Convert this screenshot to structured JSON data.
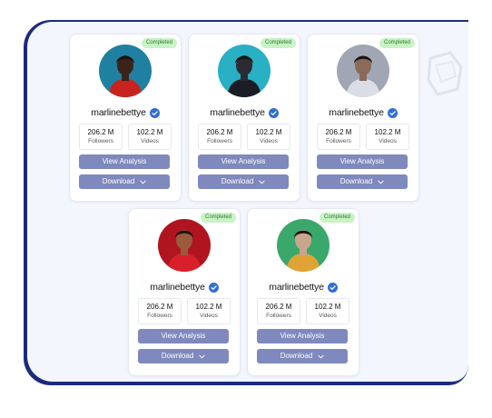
{
  "profiles": [
    {
      "badge": "Completed",
      "name": "marlinebettye",
      "followers_value": "206.2 M",
      "followers_label": "Followers",
      "videos_value": "102.2 M",
      "videos_label": "Videos",
      "analysis_label": "View Analysis",
      "download_label": "Download",
      "avatar": {
        "bg": "#1f80a2",
        "skin": "#3c231a",
        "cloth": "#c8231d"
      }
    },
    {
      "badge": "Completed",
      "name": "marlinebettye",
      "followers_value": "206.2 M",
      "followers_label": "Followers",
      "videos_value": "102.2 M",
      "videos_label": "Videos",
      "analysis_label": "View Analysis",
      "download_label": "Download",
      "avatar": {
        "bg": "#2ab0c4",
        "skin": "#2c2a33",
        "cloth": "#1c1c25"
      }
    },
    {
      "badge": "Completed",
      "name": "marlinebettye",
      "followers_value": "206.2 M",
      "followers_label": "Followers",
      "videos_value": "102.2 M",
      "videos_label": "Videos",
      "analysis_label": "View Analysis",
      "download_label": "Download",
      "avatar": {
        "bg": "#a0a6b4",
        "skin": "#8a6b5a",
        "cloth": "#d9dde6"
      }
    },
    {
      "badge": "Completed",
      "name": "marlinebettye",
      "followers_value": "206.2 M",
      "followers_label": "Followers",
      "videos_value": "102.2 M",
      "videos_label": "Videos",
      "analysis_label": "View Analysis",
      "download_label": "Download",
      "avatar": {
        "bg": "#b0151f",
        "skin": "#9a5a3c",
        "cloth": "#d8202a"
      }
    },
    {
      "badge": "Completed",
      "name": "marlinebettye",
      "followers_value": "206.2 M",
      "followers_label": "Followers",
      "videos_value": "102.2 M",
      "videos_label": "Videos",
      "analysis_label": "View Analysis",
      "download_label": "Download",
      "avatar": {
        "bg": "#3aa86a",
        "skin": "#c9a58e",
        "cloth": "#e0a436"
      }
    }
  ],
  "colors": {
    "button": "#7f89bd",
    "badge_bg": "#c8f3c4",
    "verified": "#2f6fd6",
    "frame": "#1c2a7e"
  },
  "icons": {
    "verified": "verified-badge-icon",
    "chevron": "chevron-down-icon",
    "deco": "decorative-shape-icon"
  }
}
